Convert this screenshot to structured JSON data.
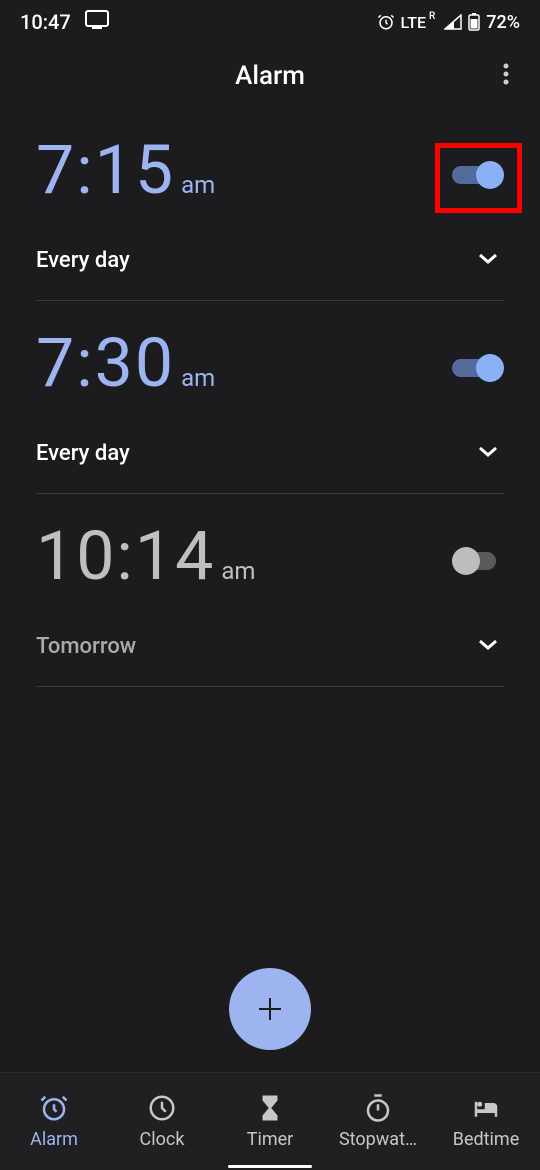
{
  "status": {
    "time": "10:47",
    "network": "LTE",
    "network_superscript": "R",
    "battery": "72%"
  },
  "appbar": {
    "title": "Alarm"
  },
  "alarms": [
    {
      "time": "7:15",
      "ampm": "am",
      "schedule": "Every day",
      "enabled": true,
      "highlighted": true
    },
    {
      "time": "7:30",
      "ampm": "am",
      "schedule": "Every day",
      "enabled": true,
      "highlighted": false
    },
    {
      "time": "10:14",
      "ampm": "am",
      "schedule": "Tomorrow",
      "enabled": false,
      "highlighted": false
    }
  ],
  "nav": {
    "items": [
      {
        "label": "Alarm",
        "active": true
      },
      {
        "label": "Clock",
        "active": false
      },
      {
        "label": "Timer",
        "active": false
      },
      {
        "label": "Stopwat…",
        "active": false
      },
      {
        "label": "Bedtime",
        "active": false
      }
    ]
  },
  "colors": {
    "accent": "#9db4f0",
    "bg": "#1c1c1f",
    "highlight": "#ff0000"
  }
}
